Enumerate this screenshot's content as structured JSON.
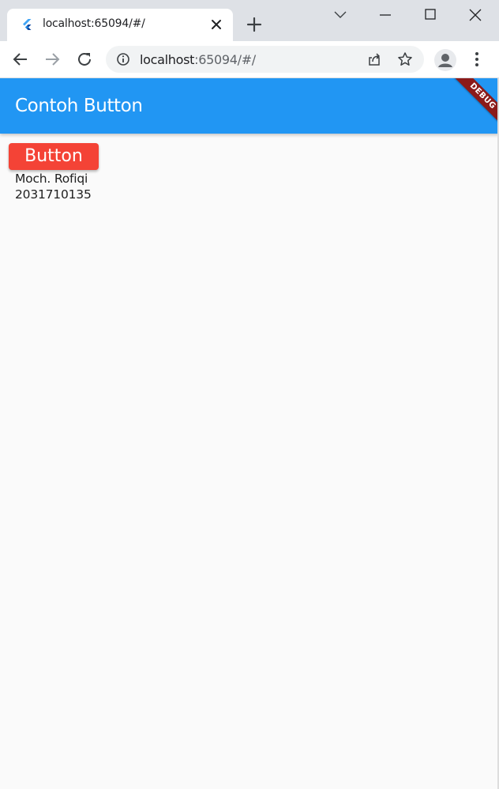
{
  "browser": {
    "tab": {
      "title": "localhost:65094/#/"
    },
    "address_bar": {
      "host": "localhost",
      "rest": ":65094/#/"
    },
    "icons": {
      "favicon": "flutter-logo-icon",
      "tab_close": "close-icon",
      "new_tab": "plus-icon",
      "tab_search": "chevron-down-icon",
      "minimize": "minimize-icon",
      "maximize": "maximize-icon",
      "close_window": "close-icon",
      "back": "arrow-left-icon",
      "forward": "arrow-right-icon",
      "reload": "reload-icon",
      "site_info": "info-icon",
      "share": "share-icon",
      "bookmark": "star-icon",
      "profile": "person-icon",
      "menu": "kebab-menu-icon"
    }
  },
  "app": {
    "appbar": {
      "title": "Contoh Button"
    },
    "debug_banner": "DEBUG",
    "button": {
      "label": "Button"
    },
    "name": "Moch. Rofiqi",
    "student_id": "2031710135"
  },
  "colors": {
    "appbar": "#2196f3",
    "button": "#f44336",
    "debug_banner": "#8b1a1a",
    "background": "#fafafa"
  }
}
